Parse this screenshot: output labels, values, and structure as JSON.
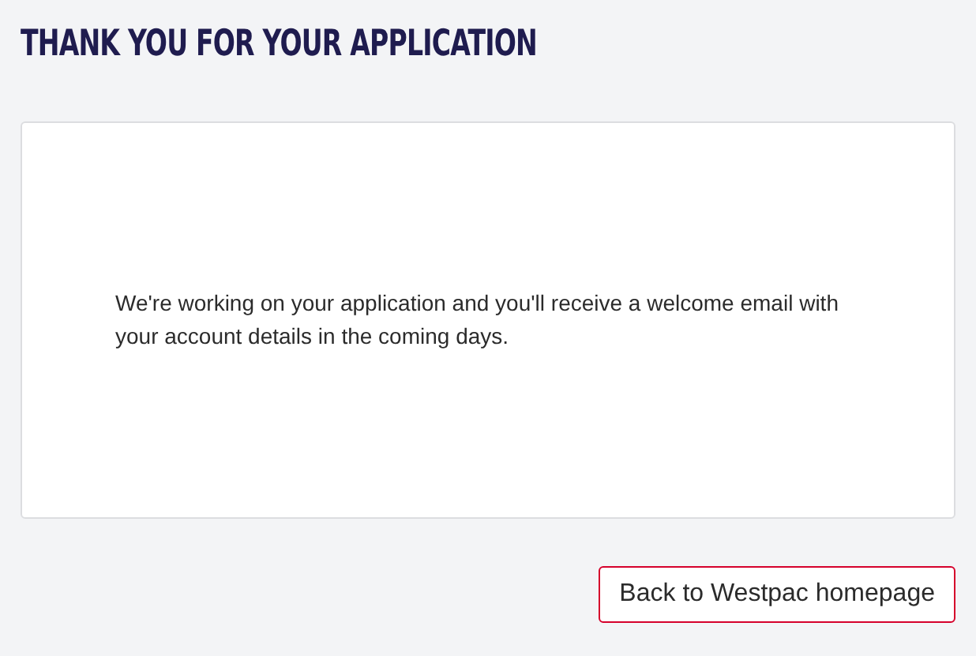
{
  "heading": "THANK YOU FOR YOUR APPLICATION",
  "message": "We're working on your application and you'll receive a welcome email with your account details in the coming days.",
  "buttons": [
    "Back to Westpac homepage"
  ]
}
